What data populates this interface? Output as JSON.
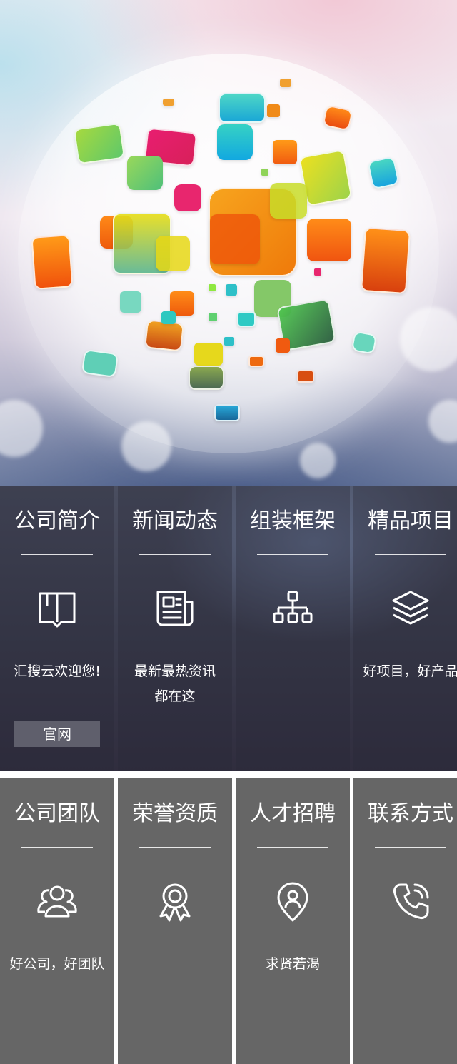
{
  "hero": {
    "colors": [
      "#f0a030",
      "#ee5a0c",
      "#e8e020",
      "#8fd358",
      "#2ec0c8",
      "#e8266e",
      "#78d8c0"
    ]
  },
  "row1": [
    {
      "title": "公司简介",
      "icon": "book-icon",
      "desc": "汇搜云欢迎您!",
      "button": "官网"
    },
    {
      "title": "新闻动态",
      "icon": "newspaper-icon",
      "desc": "最新最热资讯",
      "desc2": "都在这"
    },
    {
      "title": "组装框架",
      "icon": "sitemap-icon"
    },
    {
      "title": "精品项目",
      "icon": "layers-icon",
      "desc": "好项目，好产品"
    }
  ],
  "row2": [
    {
      "title": "公司团队",
      "icon": "team-icon",
      "desc": "好公司，好团队"
    },
    {
      "title": "荣誉资质",
      "icon": "award-icon"
    },
    {
      "title": "人才招聘",
      "icon": "location-person-icon",
      "desc": "求贤若渴"
    },
    {
      "title": "联系方式",
      "icon": "phone-icon"
    }
  ]
}
